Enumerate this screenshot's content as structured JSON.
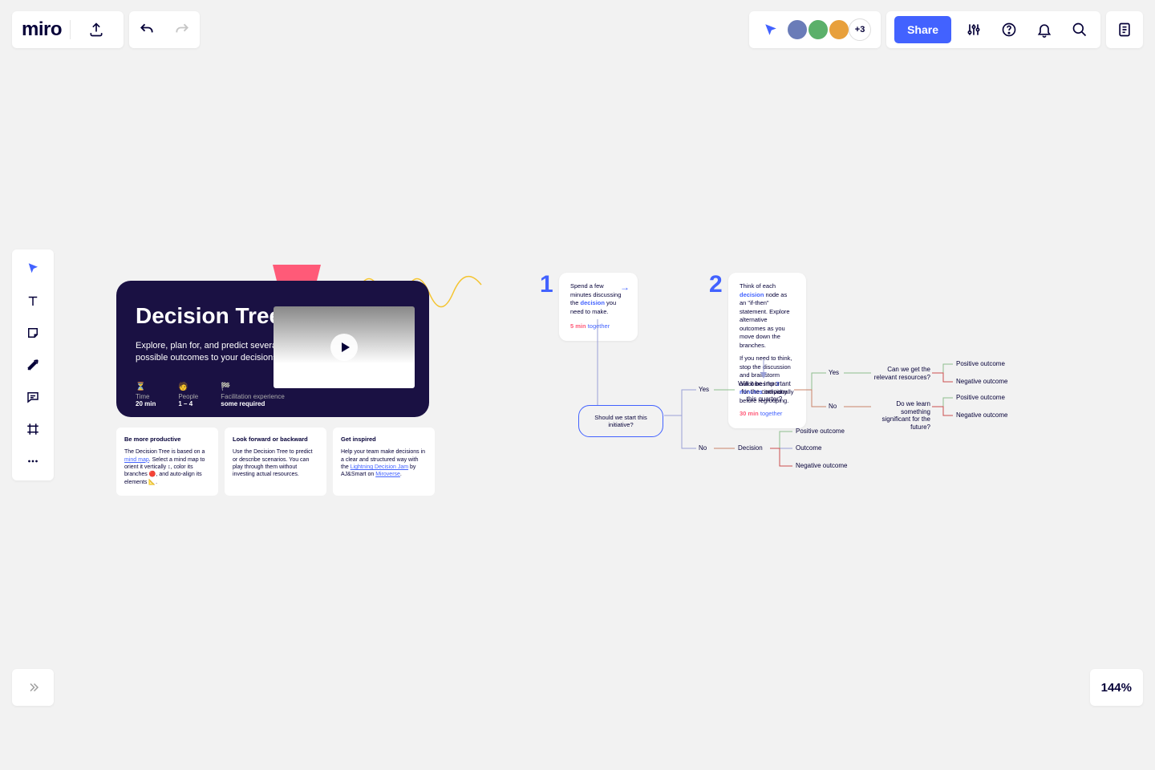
{
  "app": {
    "logo": "miro"
  },
  "toolbar": {
    "share_label": "Share",
    "avatar_more": "+3"
  },
  "zoom": {
    "level": "144%"
  },
  "hero": {
    "title": "Decision Tree",
    "subtitle": "Explore, plan for, and predict several possible outcomes to your decisions.",
    "meta": {
      "time": {
        "emoji": "⏳",
        "label": "Time",
        "value": "20 min"
      },
      "people": {
        "emoji": "🧑",
        "label": "People",
        "value": "1 – 4"
      },
      "facilitation": {
        "emoji": "🏁",
        "label": "Facilitation experience",
        "value": "some required"
      }
    }
  },
  "tips": [
    {
      "title": "Be more productive",
      "body_pre": "The Decision Tree is based on a ",
      "link": "mind map",
      "body_post": ". Select a mind map to orient it vertically ↕, color its branches 🔴, and auto-align its elements 📐."
    },
    {
      "title": "Look forward or backward",
      "body": "Use the Decision Tree to predict or describe scenarios. You can play through them without investing actual resources."
    },
    {
      "title": "Get inspired",
      "body_pre": "Help your team make decisions in a clear and structured way with the ",
      "link1": "Lightning Decision Jam",
      "body_mid": " by AJ&Smart on ",
      "link2": "Miroverse",
      "body_post": "."
    }
  ],
  "steps": {
    "s1": {
      "num": "1",
      "text_a": "Spend a few minutes discussing the ",
      "text_hl": "decision",
      "text_b": " you need to make.",
      "time": "5 min",
      "together": "together"
    },
    "s2": {
      "num": "2",
      "text_a": "Think of each ",
      "text_hl1": "decision",
      "text_b": " node as an \"if-then\" statement. Explore alternative outcomes as you move down the branches.",
      "text_c": "If you need to think, stop the discussion and brainstorm outcomes for ",
      "text_hl2": "3 minutes",
      "text_d": " individually before regrouping.",
      "time": "30 min",
      "together": "together"
    }
  },
  "tree": {
    "root": "Should we start this initiative?",
    "yes": "Yes",
    "no": "No",
    "q_importance": "Will it be important for the company this quarter?",
    "q_resources": "Can we get the relevant resources?",
    "q_learn": "Do we learn something significant for the future?",
    "decision": "Decision",
    "outcome": "Outcome",
    "positive": "Positive outcome",
    "negative": "Negative outcome"
  }
}
